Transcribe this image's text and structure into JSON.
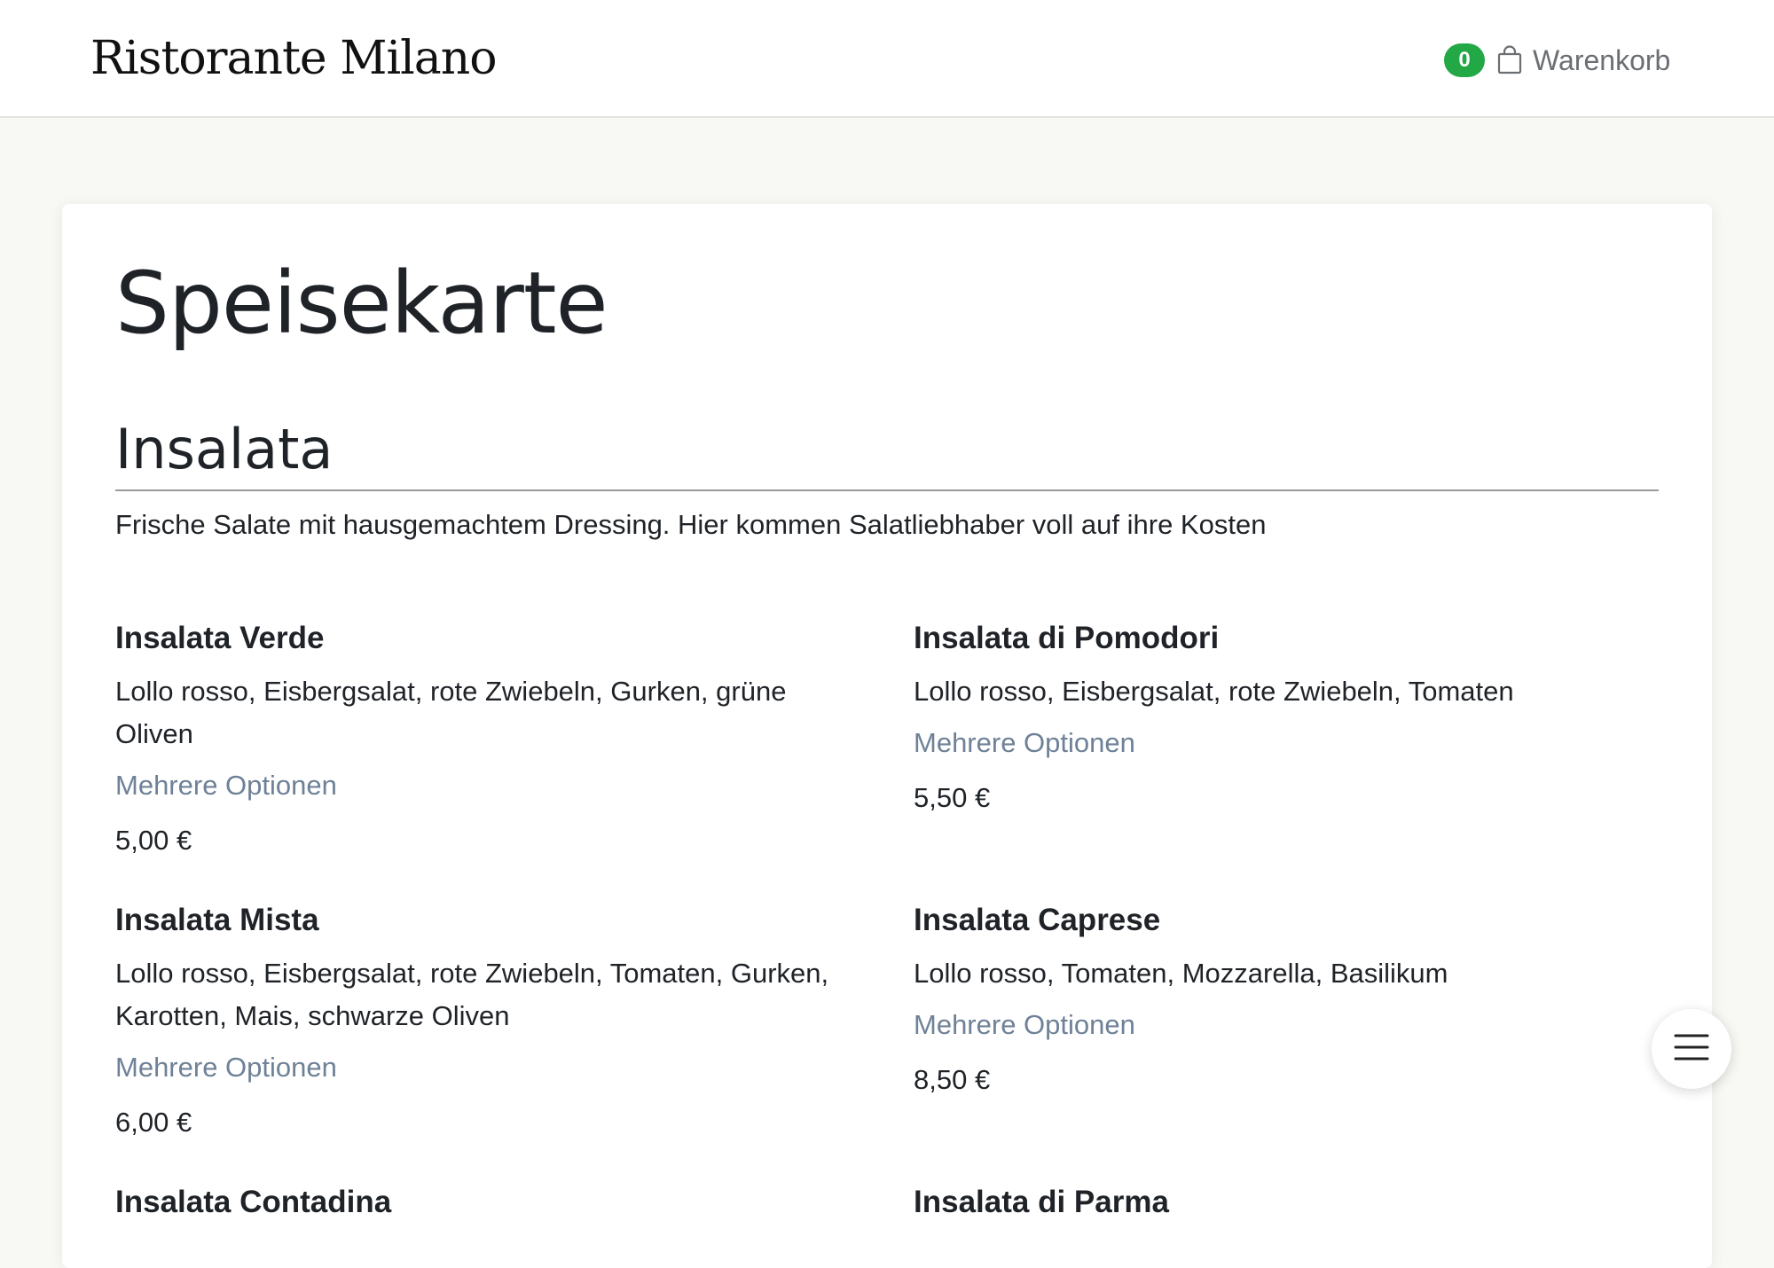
{
  "header": {
    "brand": "Ristorante Milano",
    "cart_count": "0",
    "cart_label": "Warenkorb"
  },
  "page": {
    "title": "Speisekarte"
  },
  "section": {
    "title": "Insalata",
    "description": "Frische Salate mit hausgemachtem Dressing. Hier kommen Salatliebhaber voll auf ihre Kosten"
  },
  "items": [
    {
      "name": "Insalata Verde",
      "description": "Lollo rosso, Eisbergsalat, rote Zwiebeln, Gurken, grüne Oliven",
      "options_label": "Mehrere Optionen",
      "price": "5,00 €"
    },
    {
      "name": "Insalata di Pomodori",
      "description": "Lollo rosso, Eisbergsalat, rote Zwiebeln, Tomaten",
      "options_label": "Mehrere Optionen",
      "price": "5,50 €"
    },
    {
      "name": "Insalata Mista",
      "description": "Lollo rosso, Eisbergsalat, rote Zwiebeln, Tomaten, Gurken, Karotten, Mais, schwarze Oliven",
      "options_label": "Mehrere Optionen",
      "price": "6,00 €"
    },
    {
      "name": "Insalata Caprese",
      "description": "Lollo rosso, Tomaten, Mozzarella, Basilikum",
      "options_label": "Mehrere Optionen",
      "price": "8,50 €"
    },
    {
      "name": "Insalata Contadina"
    },
    {
      "name": "Insalata di Parma"
    }
  ],
  "icons": {
    "cart": "shopping-bag-icon",
    "menu": "hamburger-menu-icon"
  },
  "colors": {
    "badge": "#23a846",
    "link": "#6e8197",
    "page_background": "#f8f8f4",
    "text": "#1f2328"
  }
}
